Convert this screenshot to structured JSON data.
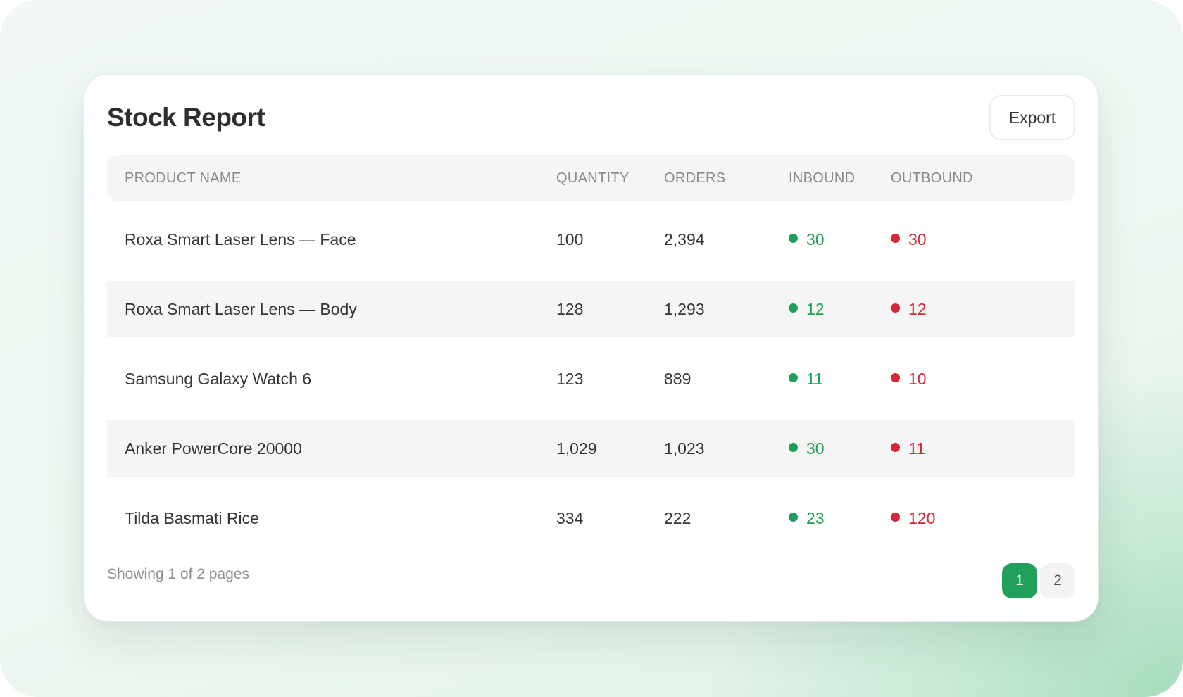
{
  "report": {
    "title": "Stock Report",
    "export_label": "Export"
  },
  "columns": {
    "product_name": "PRODUCT NAME",
    "quantity": "QUANTITY",
    "orders": "ORDERS",
    "inbound": "INBOUND",
    "outbound": "OUTBOUND"
  },
  "rows": [
    {
      "name": "Roxa Smart Laser Lens — Face",
      "quantity": "100",
      "orders": "2,394",
      "inbound": "30",
      "outbound": "30"
    },
    {
      "name": "Roxa Smart Laser Lens — Body",
      "quantity": "128",
      "orders": "1,293",
      "inbound": "12",
      "outbound": "12"
    },
    {
      "name": "Samsung Galaxy Watch 6",
      "quantity": "123",
      "orders": "889",
      "inbound": "11",
      "outbound": "10"
    },
    {
      "name": "Anker PowerCore 20000",
      "quantity": "1,029",
      "orders": "1,023",
      "inbound": "30",
      "outbound": "11"
    },
    {
      "name": "Tilda Basmati Rice",
      "quantity": "334",
      "orders": "222",
      "inbound": "23",
      "outbound": "120"
    }
  ],
  "pagination": {
    "summary": "Showing 1 of 2 pages",
    "pages": [
      "1",
      "2"
    ],
    "current": "1"
  },
  "colors": {
    "inbound": "#1f9e57",
    "outbound": "#d72638",
    "accent": "#20a05a"
  }
}
